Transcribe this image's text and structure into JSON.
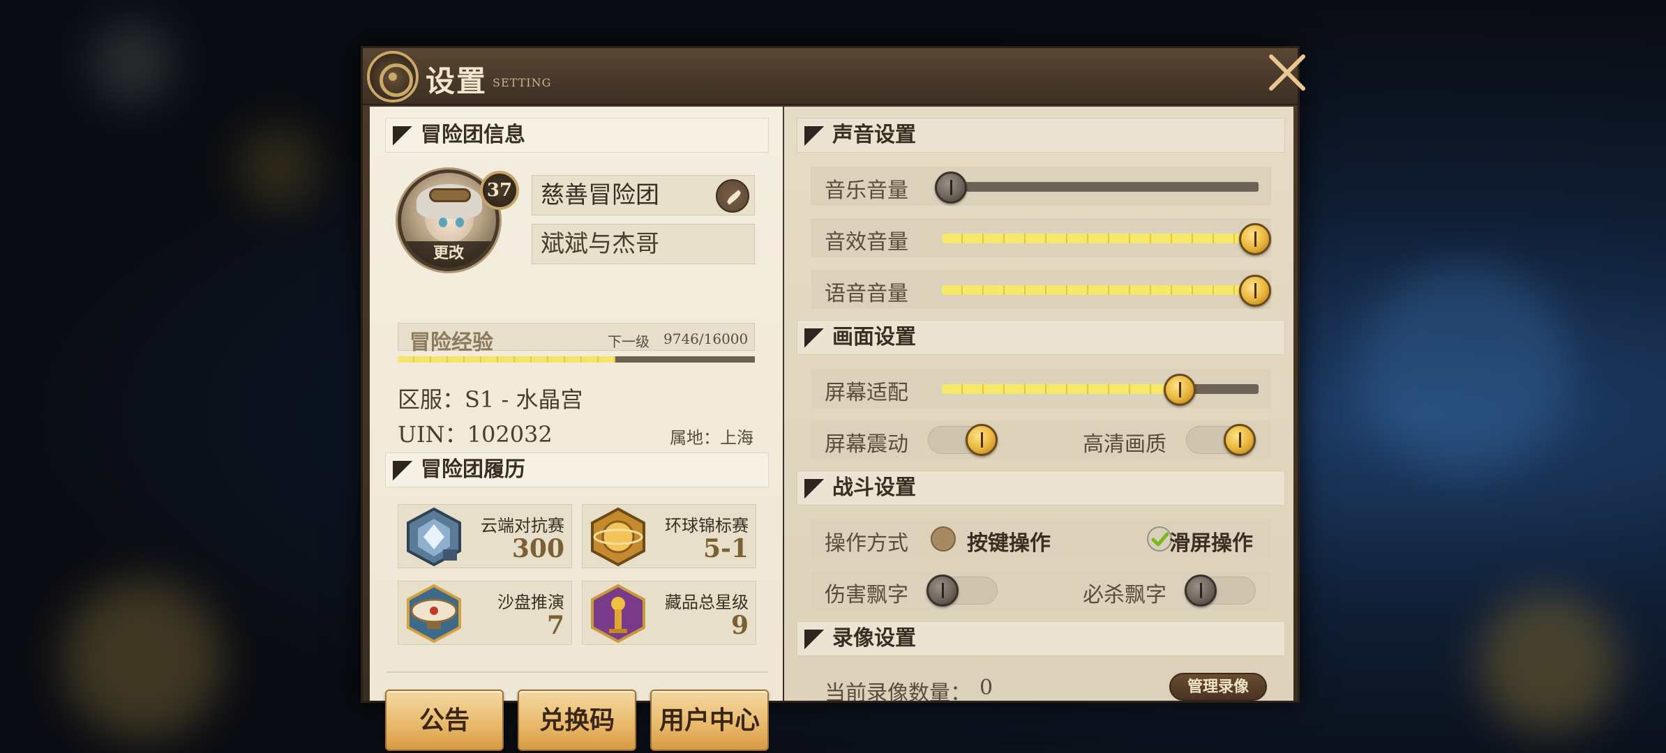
{
  "header": {
    "title": "设置",
    "subtitle": "SETTING"
  },
  "left": {
    "team_section": "冒险团信息",
    "level": "37",
    "avatar_change": "更改",
    "team_name": "慈善冒险团",
    "player_name": "斌斌与杰哥",
    "exp": {
      "label": "冒险经验",
      "next_label": "下一级",
      "value": "9746/16000",
      "progress": 0.609
    },
    "server": "区服：S1 - 水晶宫",
    "uin": "UIN：102032",
    "location": "属地：上海",
    "history_section": "冒险团履历",
    "records": [
      {
        "label": "云端对抗赛",
        "value": "300",
        "icon": "cloud-arena-badge-icon"
      },
      {
        "label": "环球锦标赛",
        "value": "5-1",
        "icon": "globe-championship-badge-icon"
      },
      {
        "label": "沙盘推演",
        "value": "7",
        "icon": "airship-sandbox-badge-icon"
      },
      {
        "label": "藏品总星级",
        "value": "9",
        "icon": "trophy-collection-badge-icon"
      }
    ],
    "buttons": {
      "notice": "公告",
      "redeem": "兑换码",
      "user_center": "用户中心"
    }
  },
  "right": {
    "sound_section": "声音设置",
    "music_volume": {
      "label": "音乐音量",
      "value": 0
    },
    "sfx_volume": {
      "label": "音效音量",
      "value": 1
    },
    "voice_volume": {
      "label": "语音音量",
      "value": 1
    },
    "display_section": "画面设置",
    "screen_fit": {
      "label": "屏幕适配",
      "value": 0.75
    },
    "screen_shake": {
      "label": "屏幕震动",
      "on": true
    },
    "hd_quality": {
      "label": "高清画质",
      "on": true
    },
    "battle_section": "战斗设置",
    "control_mode": {
      "label": "操作方式",
      "option_keys": "按键操作",
      "option_swipe": "滑屏操作",
      "selected": "滑屏操作"
    },
    "damage_text": {
      "label": "伤害飘字",
      "on": false
    },
    "crit_text": {
      "label": "必杀飘字",
      "on": false
    },
    "record_section": "录像设置",
    "recording_count": {
      "label": "当前录像数量：",
      "value": "0"
    },
    "manage_recording": "管理录像"
  },
  "colors": {
    "gold": "#e8b43a",
    "panel": "#f4eee0",
    "frame": "#3a2e22"
  }
}
